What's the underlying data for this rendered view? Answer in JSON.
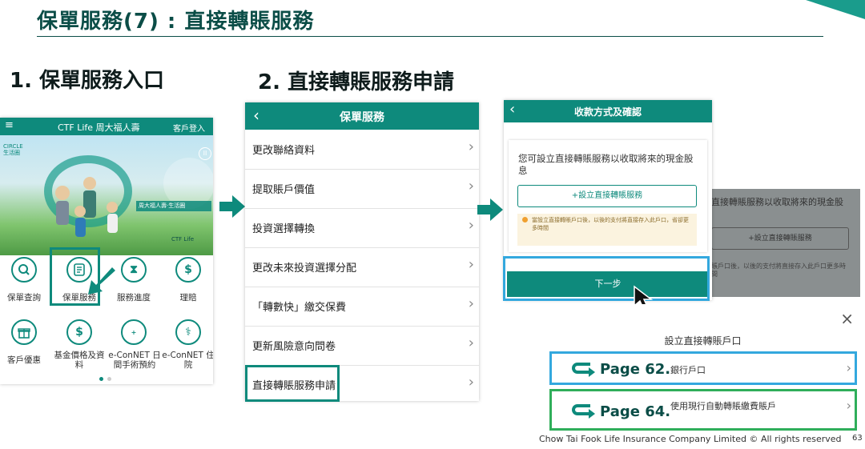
{
  "slide": {
    "title": "保單服務(7) : 直接轉賬服務",
    "step1_heading": "1. 保單服務入口",
    "step2_heading": "2. 直接轉賬服務申請",
    "footer_text": "Chow Tai Fook Life Insurance Company Limited © All rights reserved",
    "page_number": "63"
  },
  "phone1": {
    "brand": "CTF Life 周大福人壽",
    "login": "客戶登入",
    "banner_badge": "CIRCLE 生活圈",
    "banner_line1": "周大福人壽·生活圈",
    "banner_line2": "CTF Life",
    "grid": [
      {
        "label": "保單查詢",
        "icon": "search-icon"
      },
      {
        "label": "保單服務",
        "icon": "document-icon"
      },
      {
        "label": "服務進度",
        "icon": "hourglass-icon"
      },
      {
        "label": "理賠",
        "icon": "shield-dollar-icon"
      },
      {
        "label": "客戶優惠",
        "icon": "gift-icon"
      },
      {
        "label": "基金價格及資料",
        "icon": "dollar-icon"
      },
      {
        "label": "e-ConNET 日間手術預約",
        "icon": "book-icon"
      },
      {
        "label": "e-ConNET 住院",
        "icon": "hospital-icon"
      }
    ]
  },
  "phone2": {
    "header_title": "保單服務",
    "items": [
      "更改聯絡資料",
      "提取賬戶價值",
      "投資選擇轉換",
      "更改未來投資選擇分配",
      "「轉數快」繳交保費",
      "更新風險意向問卷",
      "直接轉賬服務申請"
    ]
  },
  "phone3": {
    "header_title": "收款方式及確認",
    "description": "您可設立直接轉賬服務以收取將來的現金股息",
    "setup_button": "+設立直接轉賬服務",
    "notice": "當設立直接轉賬戶口後，以後的支付將直接存入此戶口，省卻更多時間",
    "next_button": "下一步",
    "bg_description": "直接轉賬服務以收取將來的現金股",
    "bg_setup_button": "+設立直接轉賬服務",
    "bg_notice": "賬戶口後，以後的支付將直接存入此戶口更多時間"
  },
  "sheet": {
    "title": "設立直接轉賬戶口",
    "options": [
      {
        "page": "Page 62.",
        "label": "銀行戶口"
      },
      {
        "page": "Page 64.",
        "label": "使用現行自動轉賬繳費賬戶"
      }
    ]
  },
  "colors": {
    "teal": "#0e8a7c",
    "title": "#0b4d47",
    "blue_highlight": "#33a8de",
    "green_highlight": "#2fae5a"
  }
}
